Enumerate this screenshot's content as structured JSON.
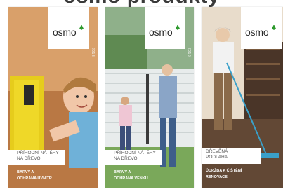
{
  "heading": "osmo",
  "brand": {
    "name": "osmo",
    "leaf_color": "#2e9a2e"
  },
  "catalogs": [
    {
      "year": "2018",
      "title": [
        "PŘÍRODNÍ NÁTĚRY",
        "NA DŘEVO"
      ],
      "subtitle": [
        "BARVY A",
        "OCHRANA UVNITŘ"
      ]
    },
    {
      "year": "2018",
      "title": [
        "PŘÍRODNÍ NÁTĚRY",
        "NA DŘEVO"
      ],
      "subtitle": [
        "BARVY A",
        "OCHRANA VENKU"
      ]
    },
    {
      "year": "",
      "title": [
        "DŘEVĚNÁ",
        "PODLAHA"
      ],
      "subtitle": [
        "ÚDRŽBA A ČIŠTĚNÍ",
        "RENOVACE"
      ]
    }
  ]
}
